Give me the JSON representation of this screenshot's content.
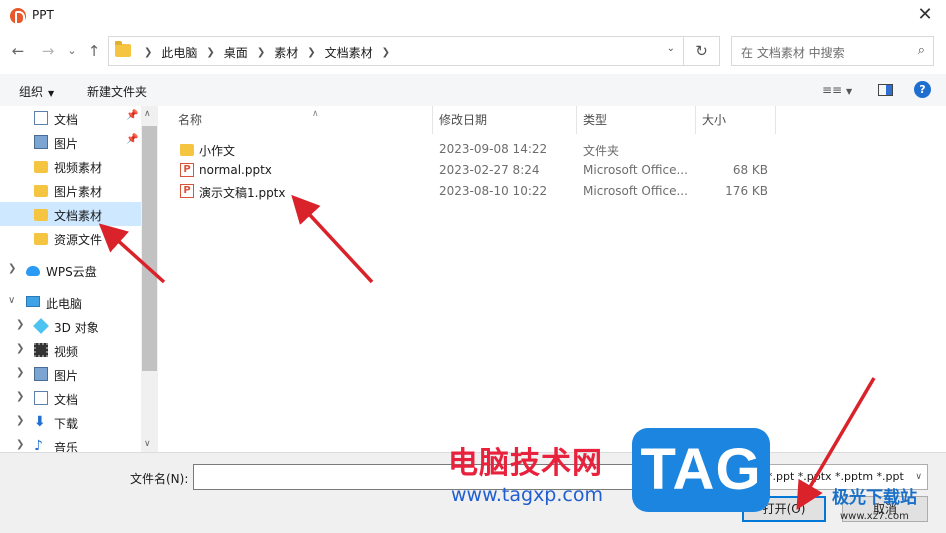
{
  "window": {
    "title": "PPT",
    "close_glyph": "✕"
  },
  "nav_buttons": {
    "back": "←",
    "forward": "→",
    "dropdown": "⌄",
    "up": "↑"
  },
  "address": {
    "crumbs": [
      "此电脑",
      "桌面",
      "素材",
      "文档素材"
    ],
    "dropdown": "⌄",
    "refresh": "↻"
  },
  "search": {
    "placeholder": "在 文档素材 中搜索",
    "icon": "search-icon"
  },
  "toolbar": {
    "organize": "组织",
    "new_folder": "新建文件夹",
    "help": "?"
  },
  "navpane": {
    "items": [
      {
        "label": "文档",
        "icon": "document-icon",
        "pinned": true
      },
      {
        "label": "图片",
        "icon": "picture-icon",
        "pinned": true
      },
      {
        "label": "视频素材",
        "icon": "folder-icon"
      },
      {
        "label": "图片素材",
        "icon": "folder-icon"
      },
      {
        "label": "文档素材",
        "icon": "folder-icon",
        "selected": true
      },
      {
        "label": "资源文件",
        "icon": "folder-icon"
      },
      {
        "label": "WPS云盘",
        "icon": "cloud-icon",
        "expandable": true
      },
      {
        "label": "此电脑",
        "icon": "computer-icon",
        "expanded": true
      },
      {
        "label": "3D 对象",
        "icon": "3d-objects-icon",
        "expandable": true
      },
      {
        "label": "视频",
        "icon": "video-icon",
        "expandable": true
      },
      {
        "label": "图片",
        "icon": "picture-icon",
        "expandable": true
      },
      {
        "label": "文档",
        "icon": "document-icon",
        "expandable": true
      },
      {
        "label": "下载",
        "icon": "download-icon",
        "expandable": true
      },
      {
        "label": "音乐",
        "icon": "music-icon",
        "expandable": true
      }
    ]
  },
  "filelist": {
    "columns": [
      "名称",
      "修改日期",
      "类型",
      "大小"
    ],
    "rows": [
      {
        "name": "小作文",
        "date": "2023-09-08 14:22",
        "type": "文件夹",
        "size": "",
        "icon": "folder-icon"
      },
      {
        "name": "normal.pptx",
        "date": "2023-02-27 8:24",
        "type": "Microsoft Office...",
        "size": "68 KB",
        "icon": "pptx-icon"
      },
      {
        "name": "演示文稿1.pptx",
        "date": "2023-08-10 10:22",
        "type": "Microsoft Office...",
        "size": "176 KB",
        "icon": "pptx-icon"
      }
    ]
  },
  "bottom": {
    "filename_label": "文件名(N):",
    "filename_value": "",
    "filter_value": "*.ppt *.pptx *.pptm *.ppt",
    "open_label": "打开(O)",
    "cancel_label": "取消"
  },
  "watermarks": {
    "site_cn": "电脑技术网",
    "site_url": "www.tagxp.com",
    "badge": "TAG",
    "right_cn": "极光下载站",
    "right_url": "www.xz7.com"
  },
  "colors": {
    "selection": "#cde8ff",
    "accent": "#0078d7",
    "arrow": "#d9222a"
  }
}
